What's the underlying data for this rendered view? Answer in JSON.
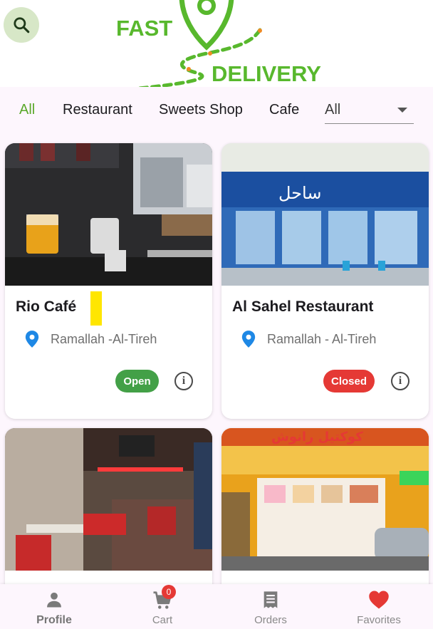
{
  "header": {
    "logo_line1": "FAST",
    "logo_line2": "DELIVERY",
    "search_icon": "search-icon"
  },
  "filters": {
    "tabs": [
      {
        "label": "All",
        "active": true
      },
      {
        "label": "Restaurant",
        "active": false
      },
      {
        "label": "Sweets Shop",
        "active": false
      },
      {
        "label": "Cafe",
        "active": false
      }
    ],
    "dropdown_value": "All"
  },
  "cards": [
    {
      "name": "Rio Café",
      "location": "Ramallah -Al-Tireh",
      "status": "Open",
      "status_color": "#43a047"
    },
    {
      "name": "Al Sahel Restaurant",
      "location": "Ramallah - Al-Tireh",
      "status": "Closed",
      "status_color": "#e53935"
    },
    {
      "name": "",
      "location": "",
      "status": "",
      "status_color": ""
    },
    {
      "name": "",
      "location": "",
      "status": "",
      "status_color": ""
    }
  ],
  "nav": {
    "items": [
      {
        "label": "Profile",
        "icon": "person-icon"
      },
      {
        "label": "Cart",
        "icon": "cart-icon",
        "badge": "0"
      },
      {
        "label": "Orders",
        "icon": "receipt-icon"
      },
      {
        "label": "Favorites",
        "icon": "heart-icon"
      }
    ]
  },
  "colors": {
    "accent": "#58b82d",
    "open": "#43a047",
    "closed": "#e53935",
    "pin": "#1e88e5"
  }
}
